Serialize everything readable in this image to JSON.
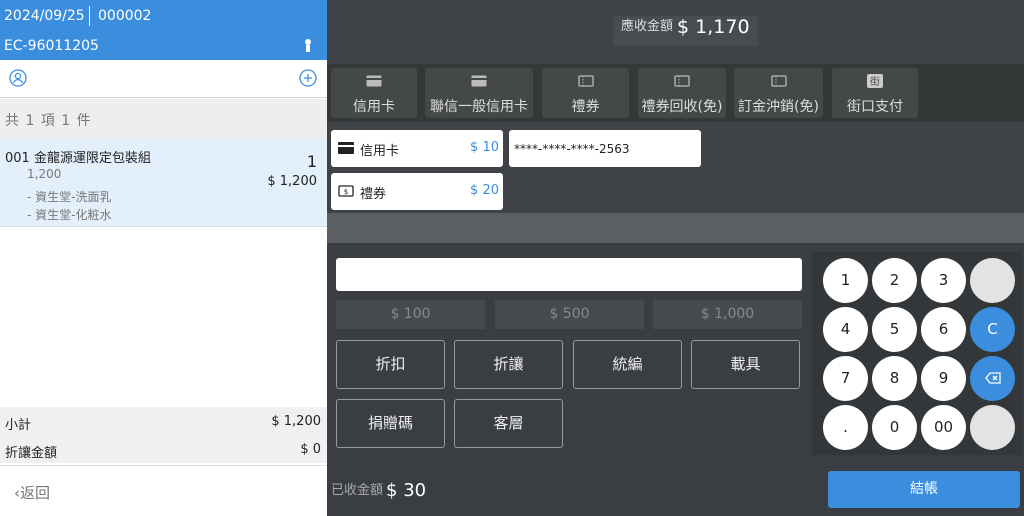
{
  "header": {
    "date": "2024/09/25",
    "serial": "000002",
    "invoice": "EC-96011205"
  },
  "summary": {
    "count_text": "共 1 項 1 件"
  },
  "item": {
    "name": "001 金龍源運限定包裝組",
    "qty": "1",
    "unit_price": "1,200",
    "total": "$ 1,200",
    "components": [
      "- 資生堂-洗面乳",
      "- 資生堂-化粧水"
    ]
  },
  "totals": {
    "subtotal_label": "小計",
    "subtotal_value": "$ 1,200",
    "discount_label": "折讓金額",
    "discount_value": "$ 0"
  },
  "nav": {
    "back_label": "返回"
  },
  "due": {
    "label": "應收金額",
    "value": "$ 1,170"
  },
  "pay_types": [
    "信用卡",
    "聯信一般信用卡",
    "禮券",
    "禮券回收(免)",
    "訂金沖銷(免)",
    "街口支付"
  ],
  "selected_payments": [
    {
      "label": "信用卡",
      "amount": "$ 10",
      "icon": "credit-card-icon"
    },
    {
      "label": "禮券",
      "amount": "$ 20",
      "icon": "voucher-icon"
    }
  ],
  "card_number": "****-****-****-2563",
  "quick_amounts": [
    "$ 100",
    "$ 500",
    "$ 1,000"
  ],
  "functions": [
    "折扣",
    "折讓",
    "統編",
    "載具",
    "捐贈碼",
    "客層"
  ],
  "keypad": {
    "r1": [
      "1",
      "2",
      "3"
    ],
    "r2": [
      "4",
      "5",
      "6"
    ],
    "r3": [
      "7",
      "8",
      "9"
    ],
    "r4": [
      ".",
      "0",
      "00"
    ],
    "clear": "C"
  },
  "footer": {
    "collected_label": "已收金額",
    "collected_value": "$ 30",
    "checkout_label": "結帳"
  },
  "colors": {
    "accent": "#3b8ede",
    "dark_bg": "#3f4347"
  }
}
